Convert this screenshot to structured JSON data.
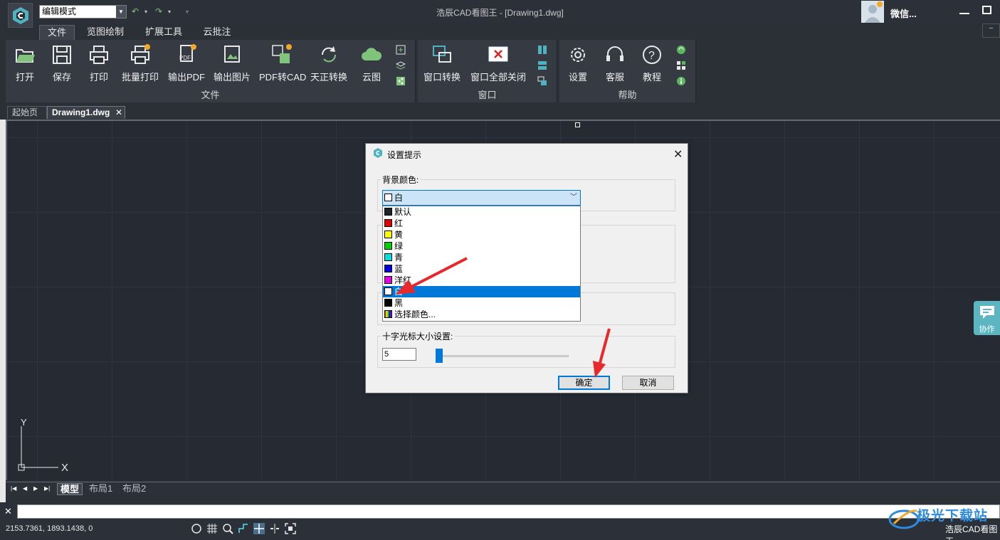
{
  "titlebar": {
    "mode": "编辑模式",
    "window_title": "浩辰CAD看图王 - [Drawing1.dwg]",
    "user_name": "微信..."
  },
  "ribbon_tabs": [
    "文件",
    "览图绘制",
    "扩展工具",
    "云批注"
  ],
  "ribbon": {
    "file_buttons": [
      "打开",
      "保存",
      "打印",
      "批量打印",
      "输出PDF",
      "输出图片",
      "PDF转CAD",
      "天正转换",
      "云图"
    ],
    "file_group": "文件",
    "window_buttons": [
      "窗口转换",
      "窗口全部关闭"
    ],
    "window_group": "窗口",
    "help_buttons": [
      "设置",
      "客服",
      "教程"
    ],
    "help_group": "帮助"
  },
  "doc_tabs": {
    "home": "起始页",
    "drawing": "Drawing1.dwg",
    "close": "✕"
  },
  "layout_tabs": [
    "模型",
    "布局1",
    "布局2"
  ],
  "ucs": {
    "y": "Y",
    "x": "X"
  },
  "collab": "协作",
  "statusbar": {
    "coords": "2153.7361, 1893.1438, 0",
    "app_name": "浩辰CAD看图王",
    "watermark": "极光下载站"
  },
  "dialog": {
    "title": "设置提示",
    "bg_color_label": "背景颜色:",
    "bg_color_value": "白",
    "color_options": [
      {
        "label": "默认",
        "color": "#1e2229"
      },
      {
        "label": "红",
        "color": "#e00000"
      },
      {
        "label": "黄",
        "color": "#ffff00"
      },
      {
        "label": "绿",
        "color": "#00d000"
      },
      {
        "label": "青",
        "color": "#00e0e0"
      },
      {
        "label": "蓝",
        "color": "#0000e0"
      },
      {
        "label": "洋红",
        "color": "#e000e0"
      },
      {
        "label": "白",
        "color": "#ffffff"
      },
      {
        "label": "黑",
        "color": "#000000"
      },
      {
        "label": "选择颜色...",
        "color": "gradient"
      }
    ],
    "selected_option": "白",
    "cursor_size_label": "十字光标大小设置:",
    "cursor_size_value": "5",
    "ok": "确定",
    "cancel": "取消"
  },
  "colors": {
    "accent": "#0078d7",
    "annotation_arrow": "#e8282b"
  }
}
